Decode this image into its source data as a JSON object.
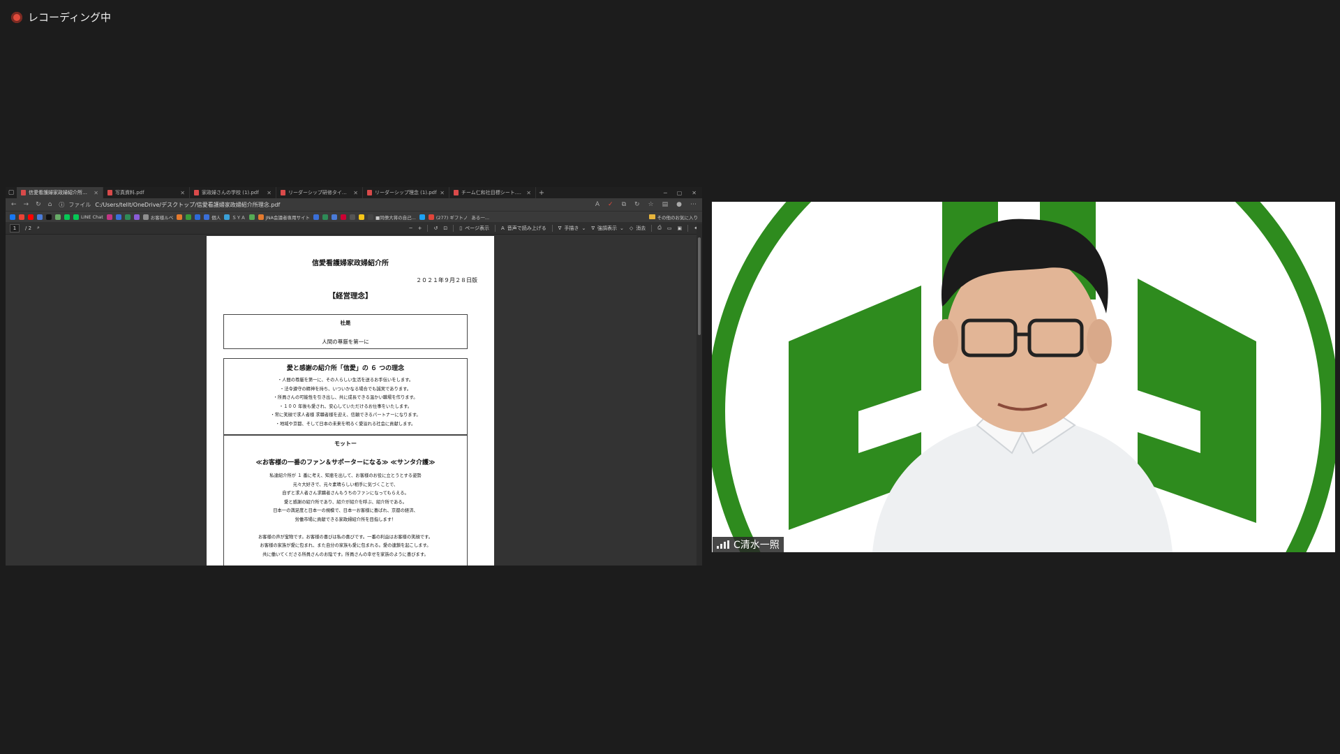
{
  "recording": {
    "label": "レコーディング中"
  },
  "browser": {
    "tabs": [
      {
        "title": "信愛看護婦家政婦紹介所理念.pdf",
        "active": true
      },
      {
        "title": "写真資料.pdf",
        "active": false
      },
      {
        "title": "家政婦さんの学校 (1).pdf",
        "active": false
      },
      {
        "title": "リーダーシップ研修タイプ2.pdf",
        "active": false
      },
      {
        "title": "リーダーシップ理念 (1).pdf",
        "active": false
      },
      {
        "title": "チーム仁和社目標シート.pdf",
        "active": false
      }
    ],
    "address": {
      "scheme_label": "ファイル",
      "url": "C:/Users/tellt/OneDrive/デスクトップ/信愛看護婦家政婦紹介所理念.pdf"
    },
    "bookmarks": [
      {
        "label": "LINE Chat",
        "color": "#06c755"
      },
      {
        "label": "お客様ルベ",
        "color": "#8e8e8e"
      },
      {
        "label": "個人",
        "color": "#3a6fd8"
      },
      {
        "label": "ＳＹＡ",
        "color": "#3aa0d8"
      },
      {
        "label": "JNA会議者専用サイト",
        "color": "#e47a2e"
      },
      {
        "label": "■同僚大将の自己...",
        "color": "#444444"
      },
      {
        "label": "(277) ギフトノ",
        "color": "#e0453a"
      },
      {
        "label": "ある一...",
        "color": "#777777"
      }
    ],
    "other_bookmarks": "その他のお気に入り"
  },
  "pdf_toolbar": {
    "page_current": "1",
    "page_total": "/ 2",
    "page_view": "ページ表示",
    "read_aloud": "音声で読み上げる",
    "draw": "手描き",
    "highlight": "強調表示",
    "erase": "消去"
  },
  "document": {
    "title": "信愛看護婦家政婦紹介所",
    "date": "２０２１年９月２８日版",
    "heading": "【経営理念】",
    "motto_box": {
      "label": "社是",
      "text": "人間の尊厳を第一に"
    },
    "principles": {
      "heading": "愛と感謝の紹介所「信愛」の ６ つの理念",
      "items": [
        "・人間の尊厳を第一に、その人らしい生活を送るお手伝いをします。",
        "・法令遵守の精神を持ち、いついかなる場合でも誠実であります。",
        "・所員さんの可能性を引き出し、共に成長できる温かい職場を作ります。",
        "・１００ 年後も愛され、安心していただけるお仕事をいたします。",
        "・常に笑顔で求人者様 求職者様を迎え、信頼できるパートナーになります。",
        "・地域や京都、そして日本の未来を明るく愛溢れる社会に貢献します。"
      ]
    },
    "motto": {
      "heading": "モットー",
      "text": "≪お客様の一番のファン＆サポーターになる≫ ≪サンタ介護≫",
      "lines": [
        "私達紹介所が １ 番に考え、知恵を出して、お客様のお役に立とうとする姿勢",
        "元々大好きで、元々素晴らしい相手に気づくことで、",
        "自ずと求人者さん求職者さんもうちのファンになってもらえる。",
        "愛と感謝の紹介所であり、紹介が紹介を呼ぶ、紹介所である。",
        "日本一の満足度と日本一の規模で、日本一お客様に喜ばれ、京都の経済、",
        "労働市場に貢献できる家政婦紹介所を目指します！"
      ],
      "lines2": [
        "お客様の声が宝物です。お客様の喜びは私の喜びです。一番の利益はお客様の笑顔です。",
        "お客様の家族が愛に包まれ、また自分の家族も愛に包まれる。愛の連鎖を起こします。",
        "共に働いてくださる所員さんのお陰です。所員さんの幸せを家族のように喜びます。"
      ]
    }
  },
  "video": {
    "participant_name": "C清水一照",
    "colors": {
      "logo_green": "#2e8b1e",
      "background": "#ffffff"
    }
  }
}
